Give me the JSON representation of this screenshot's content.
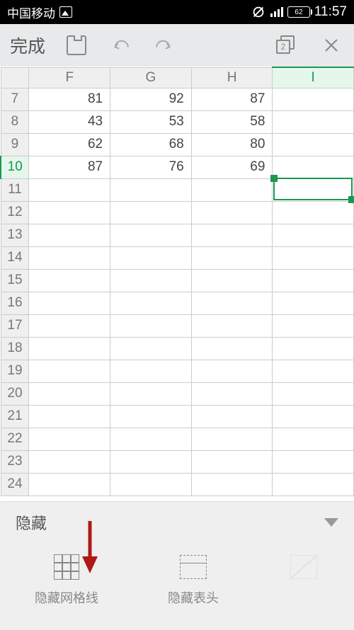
{
  "status": {
    "carrier": "中国移动",
    "battery": "62",
    "time": "11:57"
  },
  "toolbar": {
    "done_label": "完成",
    "sheet_badge": "2"
  },
  "sheet": {
    "columns": [
      "F",
      "G",
      "H",
      "I"
    ],
    "rows": [
      "7",
      "8",
      "9",
      "10",
      "11",
      "12",
      "13",
      "14",
      "15",
      "16",
      "17",
      "18",
      "19",
      "20",
      "21",
      "22",
      "23",
      "24"
    ],
    "selected_col": "I",
    "selected_row": "10",
    "cells": {
      "F7": "81",
      "G7": "92",
      "H7": "87",
      "F8": "43",
      "G8": "53",
      "H8": "58",
      "F9": "62",
      "G9": "68",
      "H9": "80",
      "F10": "87",
      "G10": "76",
      "H10": "69"
    }
  },
  "panel": {
    "title": "隐藏",
    "options": {
      "gridlines": "隐藏网格线",
      "headers": "隐藏表头",
      "diagonal": ""
    }
  }
}
